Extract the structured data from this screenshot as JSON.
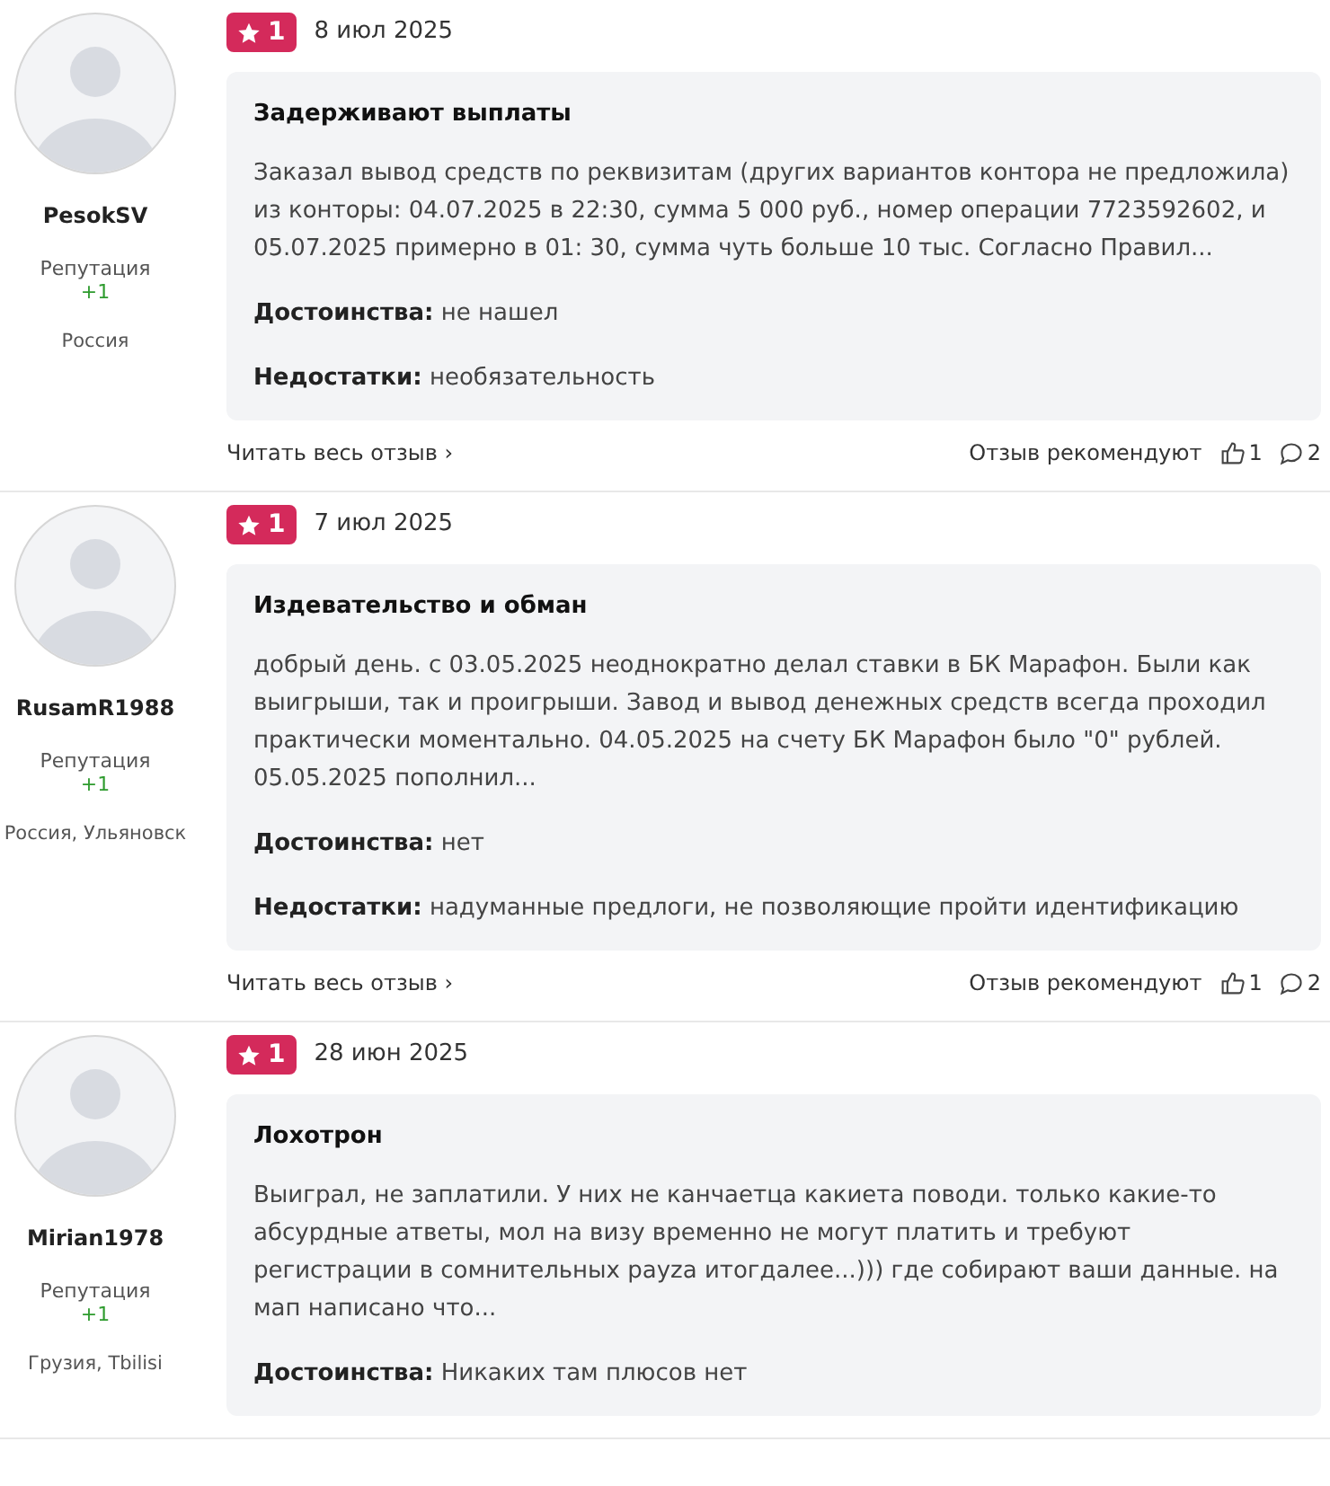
{
  "reviews": [
    {
      "author": "PesokSV",
      "reputation_label": "Репутация",
      "reputation": "+1",
      "location": "Россия",
      "rating": "1",
      "date": "8 июл 2025",
      "title": "Задерживают выплаты",
      "text": "Заказал вывод средств по реквизитам (других вариантов контора не предложила) из конторы: 04.07.2025 в 22:30, сумма 5 000 руб., номер операции 7723592602, и 05.07.2025 примерно в 01: 30, сумма чуть больше 10 тыс. Согласно Правил...",
      "pros_label": "Достоинства:",
      "pros": "не нашел",
      "cons_label": "Недостатки:",
      "cons": "необязательность",
      "read_more": "Читать весь отзыв",
      "read_more_arrow": "›",
      "recommend_label": "Отзыв рекомендуют",
      "likes": "1",
      "comments": "2"
    },
    {
      "author": "RusamR1988",
      "reputation_label": "Репутация",
      "reputation": "+1",
      "location": "Россия, Ульяновск",
      "rating": "1",
      "date": "7 июл 2025",
      "title": "Издевательство и обман",
      "text": "добрый день. с 03.05.2025 неоднократно делал ставки в БК Марафон. Были как выигрыши, так и проигрыши. Завод и вывод денежных средств всегда проходил практически моментально. 04.05.2025 на счету БК Марафон было \"0\" рублей. 05.05.2025 пополнил...",
      "pros_label": "Достоинства:",
      "pros": "нет",
      "cons_label": "Недостатки:",
      "cons": "надуманные предлоги, не позволяющие пройти идентификацию",
      "read_more": "Читать весь отзыв",
      "read_more_arrow": "›",
      "recommend_label": "Отзыв рекомендуют",
      "likes": "1",
      "comments": "2"
    },
    {
      "author": "Mirian1978",
      "reputation_label": "Репутация",
      "reputation": "+1",
      "location": "Грузия, Tbilisi",
      "rating": "1",
      "date": "28 июн 2025",
      "title": "Лохотрон",
      "text": "Выиграл, не заплатили. У них не канчаетца какиета поводи. только какие-то абсурдные атветы, мол на визу временно не могут платить и требуют регистрации в сомнительных payza итогдалее...))) где собирают ваши данные. на мап написано что...",
      "pros_label": "Достоинства:",
      "pros": "Никаких там плюсов нет"
    }
  ]
}
